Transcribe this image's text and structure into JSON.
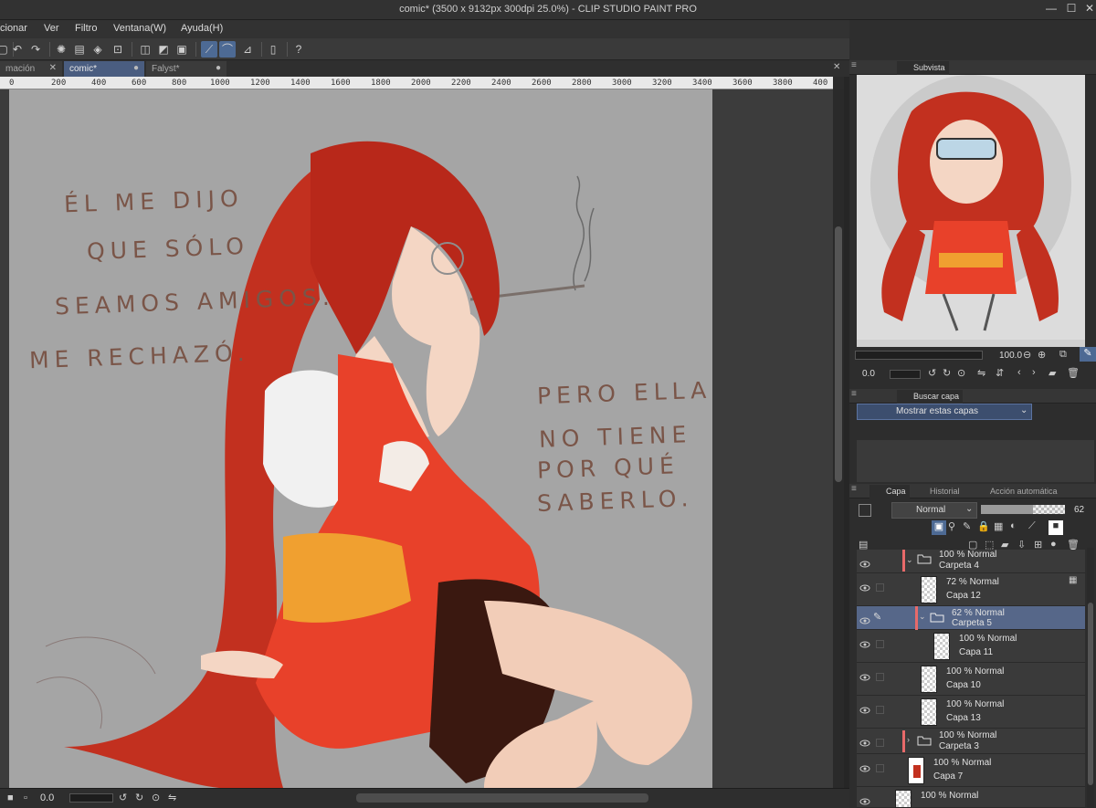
{
  "window": {
    "title": "comic* (3500 x 9132px 300dpi 25.0%)  - CLIP STUDIO PAINT PRO"
  },
  "menu": [
    "cionar",
    "Ver",
    "Filtro",
    "Ventana(W)",
    "Ayuda(H)"
  ],
  "tabs": [
    {
      "label": "mación"
    },
    {
      "label": "comic*",
      "active": true
    },
    {
      "label": "Falyst*"
    }
  ],
  "ruler": [
    "0",
    "200",
    "400",
    "600",
    "800",
    "1000",
    "1200",
    "1400",
    "1600",
    "1800",
    "2000",
    "2200",
    "2400",
    "2600",
    "2800",
    "3000",
    "3200",
    "3400",
    "3600",
    "3800",
    "400"
  ],
  "canvas": {
    "left_text": [
      "ÉL  ME  DIJO",
      "QUE  SÓLO",
      "SEAMOS  AMIGOS.",
      "ME  RECHAZÓ."
    ],
    "right_text": [
      "PERO  ELLA",
      "NO  TIENE",
      "POR  QUÉ",
      "SABERLO."
    ]
  },
  "status": {
    "angle": "0.0"
  },
  "subview": {
    "tab_label": "Subvista",
    "zoom": "100.0",
    "angle": "0.0"
  },
  "search_panel": {
    "tab_label": "Buscar capa",
    "filter_label": "Mostrar estas capas"
  },
  "layer_panel": {
    "tabs": [
      "Capa",
      "Historial",
      "Acción automática"
    ],
    "blend_mode": "Normal",
    "opacity": "62",
    "opacity_fraction": 0.62,
    "layers": [
      {
        "mode": "100 % Normal",
        "name": "Carpeta 4",
        "type": "folder",
        "indent": 0,
        "partial": true
      },
      {
        "mode": "72 % Normal",
        "name": "Capa 12",
        "type": "layer",
        "indent": 1
      },
      {
        "mode": "62 % Normal",
        "name": "Carpeta 5",
        "type": "folder",
        "indent": 1,
        "selected": true
      },
      {
        "mode": "100 % Normal",
        "name": "Capa 11",
        "type": "layer",
        "indent": 2
      },
      {
        "mode": "100 % Normal",
        "name": "Capa 10",
        "type": "layer",
        "indent": 1
      },
      {
        "mode": "100 % Normal",
        "name": "Capa 13",
        "type": "layer",
        "indent": 1
      },
      {
        "mode": "100 % Normal",
        "name": "Carpeta 3",
        "type": "folder",
        "indent": 0,
        "collapsed": true
      },
      {
        "mode": "100 % Normal",
        "name": "Capa 7",
        "type": "layer",
        "indent": 0
      },
      {
        "mode": "100 % Normal",
        "name": "",
        "type": "layer",
        "indent": 0,
        "partial": true
      }
    ]
  },
  "colors": {
    "accent": "#566789",
    "folder_tag": "#e86a6a",
    "hair": "#c2301f",
    "dress": "#e8412a",
    "sash": "#f0a030",
    "background": "#a5a5a5"
  }
}
